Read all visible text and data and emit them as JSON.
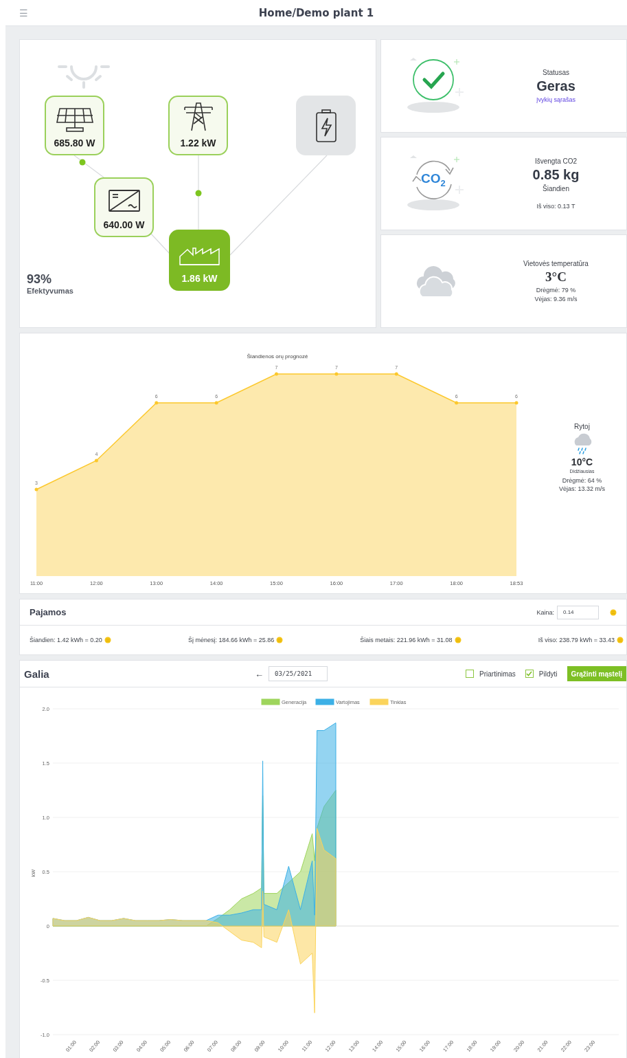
{
  "header": {
    "menu_icon": "☰",
    "title": "Home/Demo plant 1"
  },
  "flow": {
    "nodes": [
      {
        "kind": "solar",
        "value": "685.80 W"
      },
      {
        "kind": "grid",
        "value": "1.22 kW"
      },
      {
        "kind": "battery"
      },
      {
        "kind": "inverter",
        "value": "640.00 W"
      },
      {
        "kind": "home",
        "value": "1.86 kW"
      }
    ],
    "efficiency": {
      "value": "93%",
      "label": "Efektyvumas"
    }
  },
  "status": {
    "label": "Statusas",
    "value": "Geras",
    "link": "Įvykių sąrašas"
  },
  "co2": {
    "icon_text": "CO$_{2}$",
    "label": "Išvengta CO2",
    "value": "0.85 kg",
    "period": "Šiandien",
    "total": "Iš viso: 0.13 T"
  },
  "temperature": {
    "label": "Vietovės temperatūra",
    "value": "3°C",
    "humidity": "Drėgmė: 79 %",
    "wind": "Vėjas: 9.36 m/s"
  },
  "forecast": {
    "chart_data": {
      "type": "line",
      "title": "Šiandienos orų prognozė",
      "categories": [
        "11:00",
        "12:00",
        "13:00",
        "14:00",
        "15:00",
        "16:00",
        "17:00",
        "18:00",
        "18:53"
      ],
      "series": [
        {
          "color": "#fcc82c",
          "values": [
            3,
            4,
            6,
            6,
            7,
            7,
            7,
            6,
            6
          ]
        }
      ],
      "data_labels": true
    },
    "tomorrow": {
      "label": "Rytoj",
      "value": "10°C",
      "caption": "Didžiausias",
      "humidity": "Drėgmė: 64 %",
      "wind": "Vėjas: 13.32 m/s"
    }
  },
  "income": {
    "title": "Pajamos",
    "price_label": "Kaina:",
    "price": "0.14",
    "items": [
      "Šiandien: 1.42 kWh = 0.20",
      "Šį mėnesį: 184.66 kWh = 25.86",
      "Šiais metais: 221.96 kWh = 31.08",
      "Iš viso: 238.79 kWh = 33.43"
    ]
  },
  "power": {
    "title": "Galia",
    "back_icon": "←",
    "date": "03/25/2021",
    "options": [
      {
        "label": "Priartinimas",
        "checked": false
      },
      {
        "label": "Pildyti",
        "checked": true
      }
    ],
    "reset_button": "Grąžinti mąstelį",
    "chart_data": {
      "type": "area",
      "ylabel": "kW",
      "x": [
        0,
        0.5,
        1,
        1.5,
        2,
        2.5,
        3,
        3.5,
        4,
        4.5,
        5,
        5.5,
        6,
        6.5,
        7,
        7.5,
        8,
        8.5,
        8.85,
        8.9,
        8.95,
        9.5,
        10,
        10.5,
        11,
        11.1,
        11.2,
        11.5,
        12
      ],
      "series": [
        {
          "name": "Generacija",
          "color": "#9ed55c",
          "values": [
            0,
            0,
            0,
            0,
            0,
            0,
            0,
            0,
            0,
            0,
            0,
            0,
            0,
            0,
            0.07,
            0.15,
            0.25,
            0.3,
            0.35,
            1.2,
            0.3,
            0.3,
            0.4,
            0.5,
            0.85,
            0.6,
            0.9,
            1.1,
            1.25
          ]
        },
        {
          "name": "Vartojimas",
          "color": "#3cb0e6",
          "values": [
            0.07,
            0.05,
            0.05,
            0.08,
            0.05,
            0.05,
            0.07,
            0.05,
            0.05,
            0.05,
            0.06,
            0.05,
            0.05,
            0.05,
            0.1,
            0.1,
            0.12,
            0.15,
            0.15,
            1.52,
            0.2,
            0.15,
            0.55,
            0.15,
            0.6,
            0.1,
            1.8,
            1.8,
            1.87
          ]
        },
        {
          "name": "Tinklas",
          "color": "#fbd45c",
          "values": [
            0.07,
            0.05,
            0.05,
            0.08,
            0.05,
            0.05,
            0.07,
            0.05,
            0.05,
            0.05,
            0.06,
            0.05,
            0.05,
            0.05,
            0.03,
            -0.05,
            -0.13,
            -0.15,
            -0.2,
            0.32,
            -0.1,
            -0.15,
            0.15,
            -0.35,
            -0.25,
            -0.8,
            0.9,
            0.7,
            0.62
          ]
        }
      ],
      "xlim": [
        0,
        24
      ],
      "ylim": [
        -1,
        2
      ],
      "grid": true,
      "legend": true,
      "yticks": [
        {
          "value": 2,
          "label": "2.0"
        },
        1.5,
        {
          "value": 1,
          "label": "1.0"
        },
        0.5,
        0,
        -0.5,
        {
          "value": -1,
          "label": "-1.0"
        }
      ],
      "xticks": [
        {
          "value": 1,
          "label": "01:00"
        },
        {
          "value": 2,
          "label": "02:00"
        },
        {
          "value": 3,
          "label": "03:00"
        },
        {
          "value": 4,
          "label": "04:00"
        },
        {
          "value": 5,
          "label": "05:00"
        },
        {
          "value": 6,
          "label": "06:00"
        },
        {
          "value": 7,
          "label": "07:00"
        },
        {
          "value": 8,
          "label": "08:00"
        },
        {
          "value": 9,
          "label": "09:00"
        },
        {
          "value": 10,
          "label": "10:00"
        },
        {
          "value": 11,
          "label": "11:00"
        },
        {
          "value": 12,
          "label": "12:00"
        },
        {
          "value": 13,
          "label": "13:00"
        },
        {
          "value": 14,
          "label": "14:00"
        },
        {
          "value": 15,
          "label": "15:00"
        },
        {
          "value": 16,
          "label": "16:00"
        },
        {
          "value": 17,
          "label": "17:00"
        },
        {
          "value": 18,
          "label": "18:00"
        },
        {
          "value": 19,
          "label": "19:00"
        },
        {
          "value": 20,
          "label": "20:00"
        },
        {
          "value": 21,
          "label": "21:00"
        },
        {
          "value": 22,
          "label": "22:00"
        },
        {
          "value": 23,
          "label": "23:00"
        }
      ]
    }
  }
}
